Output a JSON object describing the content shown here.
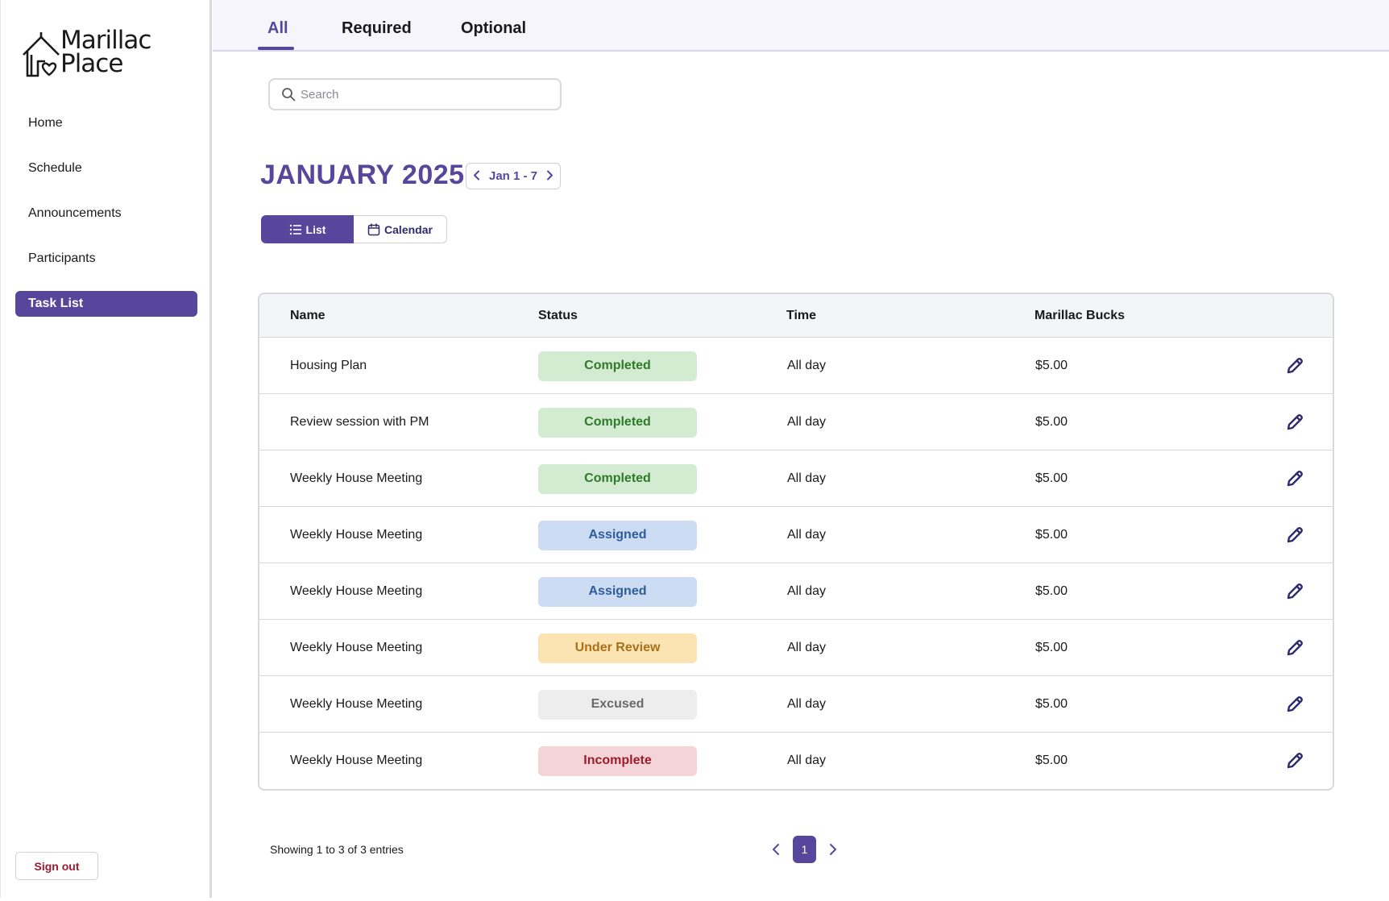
{
  "brand": {
    "line1": "Marillac",
    "line2": "Place"
  },
  "sidebar": {
    "items": [
      {
        "label": "Home"
      },
      {
        "label": "Schedule"
      },
      {
        "label": "Announcements"
      },
      {
        "label": "Participants"
      },
      {
        "label": "Task List",
        "active": true
      }
    ],
    "signout_label": "Sign out"
  },
  "tabs": [
    {
      "label": "All",
      "active": true
    },
    {
      "label": "Required"
    },
    {
      "label": "Optional"
    }
  ],
  "search": {
    "placeholder": "Search",
    "value": ""
  },
  "header": {
    "month": "JANUARY 2025",
    "range": "Jan 1 - 7"
  },
  "view_toggle": {
    "list_label": "List",
    "calendar_label": "Calendar",
    "selected": "List"
  },
  "table": {
    "columns": [
      "Name",
      "Status",
      "Time",
      "Marillac Bucks"
    ],
    "rows": [
      {
        "name": "Housing Plan",
        "status": "Completed",
        "time": "All day",
        "bucks": "$5.00"
      },
      {
        "name": "Review session with PM",
        "status": "Completed",
        "time": "All day",
        "bucks": "$5.00"
      },
      {
        "name": "Weekly House Meeting",
        "status": "Completed",
        "time": "All day",
        "bucks": "$5.00"
      },
      {
        "name": "Weekly House Meeting",
        "status": "Assigned",
        "time": "All day",
        "bucks": "$5.00"
      },
      {
        "name": "Weekly House Meeting",
        "status": "Assigned",
        "time": "All day",
        "bucks": "$5.00"
      },
      {
        "name": "Weekly House Meeting",
        "status": "Under Review",
        "time": "All day",
        "bucks": "$5.00"
      },
      {
        "name": "Weekly House Meeting",
        "status": "Excused",
        "time": "All day",
        "bucks": "$5.00"
      },
      {
        "name": "Weekly House Meeting",
        "status": "Incomplete",
        "time": "All day",
        "bucks": "$5.00"
      }
    ]
  },
  "status_colors": {
    "Completed": {
      "bg": "#d3ecd1",
      "fg": "#2f7a2a"
    },
    "Assigned": {
      "bg": "#cbdcf3",
      "fg": "#2f5c9a"
    },
    "Under Review": {
      "bg": "#fbe4b2",
      "fg": "#a8701a"
    },
    "Excused": {
      "bg": "#ededed",
      "fg": "#6a6a6a"
    },
    "Incomplete": {
      "bg": "#f5d4d8",
      "fg": "#9b1b2f"
    }
  },
  "footer": {
    "showing": "Showing 1 to 3 of 3 entries",
    "current_page": "1"
  },
  "colors": {
    "accent": "#56469c"
  }
}
